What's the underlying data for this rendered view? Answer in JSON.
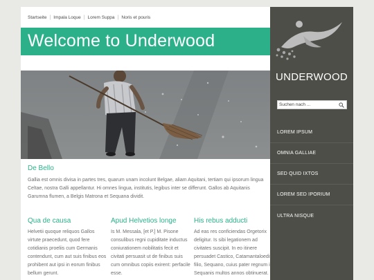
{
  "topnav": {
    "items": [
      "Startseite",
      "Impala Loque",
      "Lorem Suppa",
      "Noris et pouris"
    ]
  },
  "banner": {
    "title": "Welcome to Underwood"
  },
  "hero": {
    "icon": "man-sweeping-photo"
  },
  "intro": {
    "heading": "De Bello",
    "text": "Gallia est omnis divisa in partes tres, quarum unam incolunt Belgae, aliam Aquitani, tertiam qui ipsorum lingua Celtae, nostra Galli appellantur. Hi omnes lingua, institutis, legibus inter se differunt. Gallos ab Aquitanis Garumna flumen, a Belgis Matrona et Sequana dividit."
  },
  "columns": [
    {
      "heading": "Qua de causa",
      "text": "Helvetii quoque reliquos Gallos virtute praecedunt, quod fere cotidianis proeliis cum Germanis contendunt, cum aut suis finibus eos prohibent aut ipsi in eorum finibus bellum gerunt."
    },
    {
      "heading": "Apud Helvetios longe",
      "text": "Is M. Messala, [et P.] M. Pisone consulibus regni cupiditate inductus coniurationem nobilitatis fecit et civitati persuasit ut de finibus suis cum omnibus copiis exirent: perfacile esse."
    },
    {
      "heading": "His rebus adducti",
      "text": "Ad eas res conficiendas Orgetorix deligitur. Is sibi legationem ad civitates suscipit. In eo itinere persuadet Castico, Catamantaloedis filio, Sequano, cuius pater regnum in Sequanis multos annos obtinuerat."
    }
  ],
  "sidebar": {
    "logo_text": "UNDERWOOD",
    "logo_icon": "swimmer-logo-icon",
    "search_placeholder": "Suchen nach ...",
    "search_icon": "search-icon",
    "menu": [
      "LOREM IPSUM",
      "OMNIA GALLIAE",
      "SED QUID IXTOS",
      "LOREM SED IPORIUM",
      "ULTRA NISQUE"
    ]
  },
  "colors": {
    "accent": "#2bb08a",
    "sidebar_bg": "#4d4e48",
    "page_bg": "#e9e9e6"
  }
}
